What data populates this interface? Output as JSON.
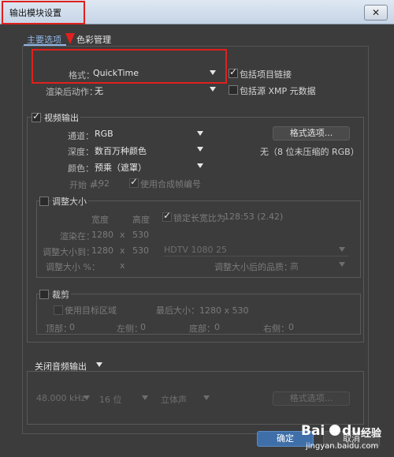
{
  "window": {
    "title": "输出模块设置",
    "close_label": "✕"
  },
  "tabs": [
    {
      "label": "主要选项"
    },
    {
      "label": "色彩管理"
    }
  ],
  "format": {
    "label": "格式：",
    "value": "QuickTime",
    "include_link_label": "包括项目链接",
    "include_link_checked": true
  },
  "post_render": {
    "label": "渲染后动作：",
    "value": "无",
    "include_xmp_label": "包括源 XMP 元数据",
    "include_xmp_checked": false
  },
  "video": {
    "title": "视频输出",
    "checked": true,
    "channel_label": "通道：",
    "channel_value": "RGB",
    "depth_label": "深度：",
    "depth_value": "数百万种颜色",
    "color_label": "颜色：",
    "color_value": "预乘（遮罩）",
    "start_label": "开始 #：",
    "start_value": "192",
    "use_comp_frame_label": "使用合成帧编号",
    "format_options_label": "格式选项...",
    "codec_info": "无（8 位未压缩的 RGB）"
  },
  "resize": {
    "title": "调整大小",
    "width_header": "宽度",
    "height_header": "高度",
    "lock_aspect_label": "锁定长宽比为",
    "lock_aspect_value": "128:53 (2.42)",
    "render_at_label": "渲染在：",
    "render_w": "1280",
    "render_x": "x",
    "render_h": "530",
    "resize_to_label": "调整大小到：",
    "resize_w": "1280",
    "resize_x": "x",
    "resize_h": "530",
    "preset_value": "HDTV 1080 25",
    "resize_pct_label": "调整大小 %：",
    "resize_pct_x": "x",
    "quality_label": "调整大小后的品质：",
    "quality_value": "高"
  },
  "crop": {
    "title": "裁剪",
    "use_roi_label": "使用目标区域",
    "max_size_label": "最后大小：1280 x 530",
    "top_label": "顶部：",
    "top_value": "0",
    "left_label": "左侧：",
    "left_value": "0",
    "bottom_label": "底部：",
    "bottom_value": "0",
    "right_label": "右侧：",
    "right_value": "0"
  },
  "audio": {
    "toggle_label": "关闭音频输出",
    "rate_value": "48.000 kHz",
    "bits_value": "16 位",
    "channels_value": "立体声",
    "format_options_label": "格式选项..."
  },
  "footer": {
    "ok_label": "确定",
    "cancel_label": "取消"
  },
  "watermark": {
    "brand": "Bai",
    "du": "du",
    "suffix": "经验",
    "url": "jingyan.baidu.com"
  }
}
